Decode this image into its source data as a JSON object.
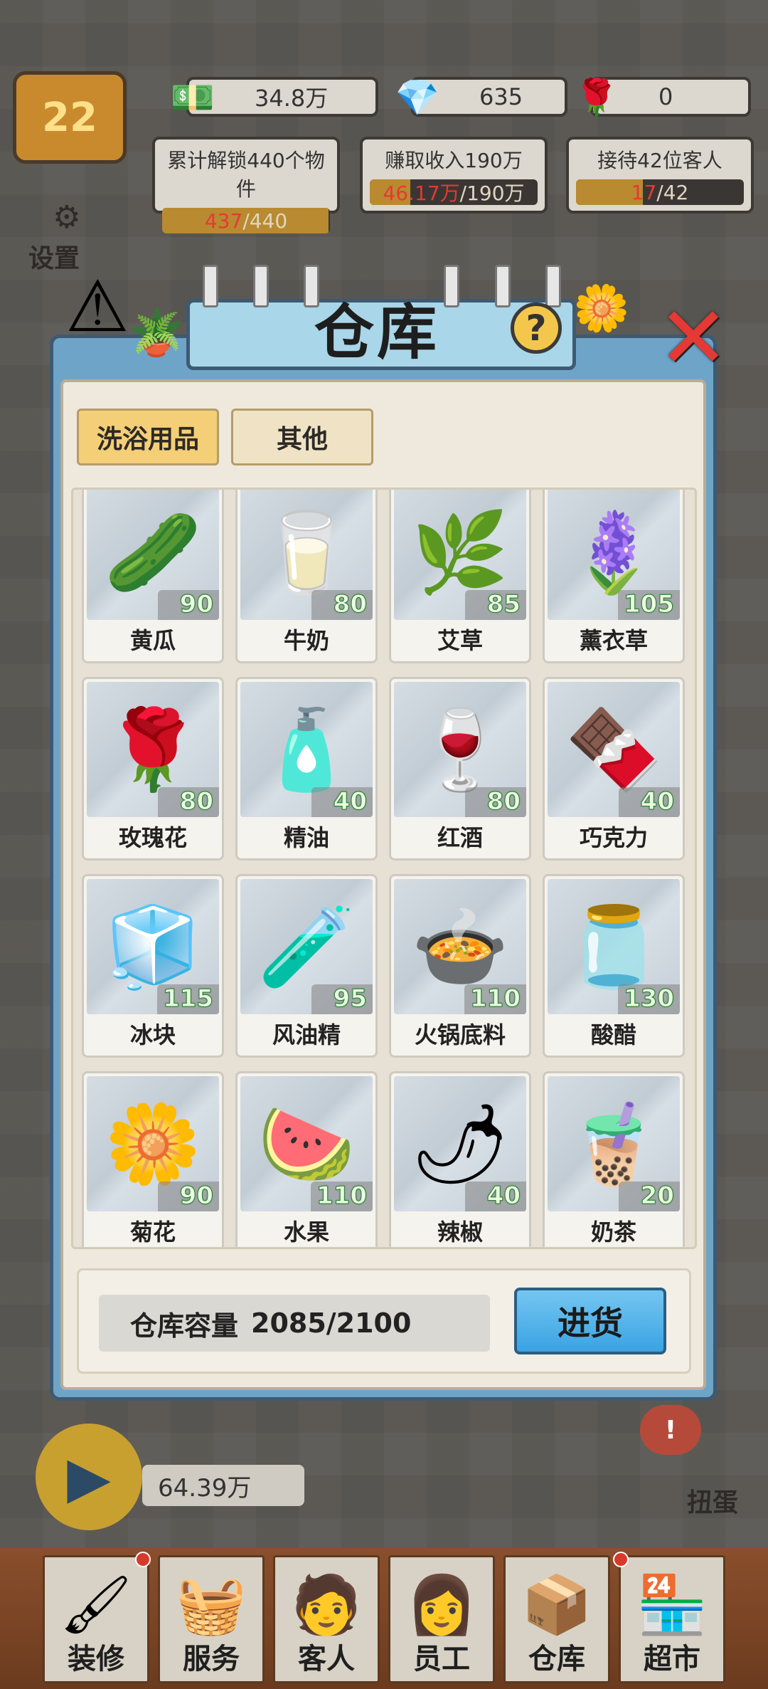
{
  "hud": {
    "level": "22",
    "cash": "34.8万",
    "gems": "635",
    "roses": "0"
  },
  "goals": [
    {
      "label": "累计解锁440个物件",
      "current": "437",
      "total": "/440",
      "progress": 0.993
    },
    {
      "label": "赚取收入190万",
      "current": "46.17万",
      "total": "/190万",
      "progress": 0.243
    },
    {
      "label": "接待42位客人",
      "current": "17",
      "total": "/42",
      "progress": 0.405
    }
  ],
  "side": {
    "settings_label": "设置"
  },
  "modal": {
    "title": "仓库",
    "help_icon": "question-icon",
    "close_icon": "close-icon",
    "tabs": [
      {
        "label": "洗浴用品",
        "active": true
      },
      {
        "label": "其他",
        "active": false
      }
    ],
    "items": [
      {
        "name": "黄瓜",
        "qty": "90",
        "icon": "🥒"
      },
      {
        "name": "牛奶",
        "qty": "80",
        "icon": "🥛"
      },
      {
        "name": "艾草",
        "qty": "85",
        "icon": "🌿"
      },
      {
        "name": "薰衣草",
        "qty": "105",
        "icon": "🪻"
      },
      {
        "name": "玫瑰花",
        "qty": "80",
        "icon": "🌹"
      },
      {
        "name": "精油",
        "qty": "40",
        "icon": "🧴"
      },
      {
        "name": "红酒",
        "qty": "80",
        "icon": "🍷"
      },
      {
        "name": "巧克力",
        "qty": "40",
        "icon": "🍫"
      },
      {
        "name": "冰块",
        "qty": "115",
        "icon": "🧊"
      },
      {
        "name": "风油精",
        "qty": "95",
        "icon": "🧪"
      },
      {
        "name": "火锅底料",
        "qty": "110",
        "icon": "🍲"
      },
      {
        "name": "酸醋",
        "qty": "130",
        "icon": "🫙"
      },
      {
        "name": "菊花",
        "qty": "90",
        "icon": "🌼"
      },
      {
        "name": "水果",
        "qty": "110",
        "icon": "🍉"
      },
      {
        "name": "辣椒",
        "qty": "40",
        "icon": "🌶"
      },
      {
        "name": "奶茶",
        "qty": "20",
        "icon": "🧋"
      }
    ],
    "capacity_label": "仓库容量",
    "capacity_value": "2085/2100",
    "restock_label": "进货"
  },
  "bottom": {
    "reward": "64.39万",
    "gacha_label": "扭蛋",
    "gacha_badge": "!",
    "nav": [
      {
        "label": "装修",
        "icon": "🖌"
      },
      {
        "label": "服务",
        "icon": "🧺"
      },
      {
        "label": "客人",
        "icon": "🧑"
      },
      {
        "label": "员工",
        "icon": "👩"
      },
      {
        "label": "仓库",
        "icon": "📦"
      },
      {
        "label": "超市",
        "icon": "🏪"
      }
    ]
  },
  "colors": {
    "modal_frame": "#6fa4c9",
    "tab_active": "#f5cf77",
    "restock_button": "#3aa3e3",
    "qty_text": "#2e7d32"
  }
}
